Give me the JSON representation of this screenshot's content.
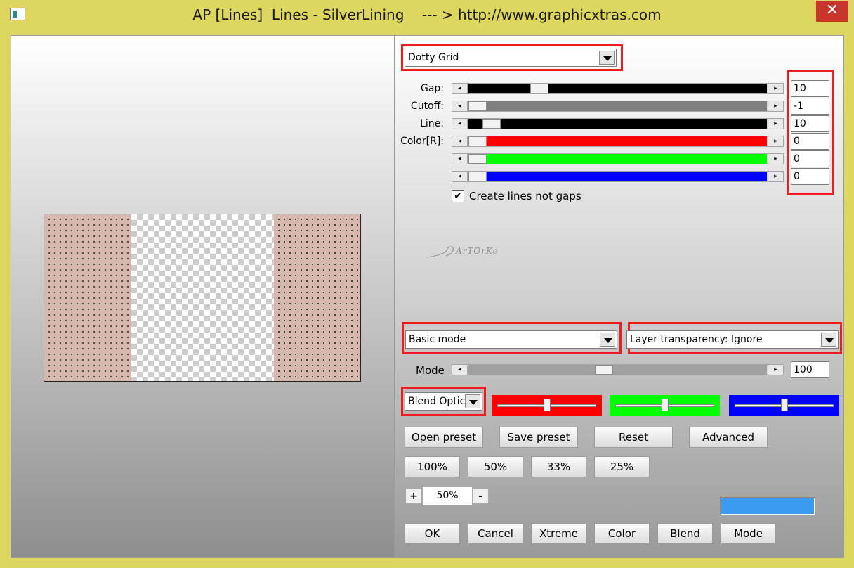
{
  "window": {
    "title": "AP [Lines]  Lines - SilverLining    --- > http://www.graphicxtras.com",
    "close_glyph": "✕"
  },
  "pattern_dropdown": {
    "value": "Dotty Grid"
  },
  "sliders": [
    {
      "label": "Gap:",
      "value": "10",
      "fill": "#000000",
      "thumb_fraction": 0.22
    },
    {
      "label": "Cutoff:",
      "value": "-1",
      "fill": "#808080",
      "thumb_fraction": 0.0
    },
    {
      "label": "Line:",
      "value": "10",
      "fill": "#000000",
      "thumb_fraction": 0.05
    },
    {
      "label": "Color[R]:",
      "value": "0",
      "fill": "#ff0000",
      "thumb_fraction": 0.0
    },
    {
      "label": "",
      "value": "0",
      "fill": "#00ff00",
      "thumb_fraction": 0.0
    },
    {
      "label": "",
      "value": "0",
      "fill": "#0000ff",
      "thumb_fraction": 0.0
    }
  ],
  "checkbox": {
    "label": "Create lines not gaps",
    "checked": true,
    "glyph": "✔"
  },
  "watermark": "ArTOrKe",
  "mode_dropdown": {
    "value": "Basic mode"
  },
  "transparency_dropdown": {
    "value": "Layer transparency: Ignore"
  },
  "mode_slider": {
    "label": "Mode",
    "value": "100",
    "thumb_fraction": 0.45
  },
  "blend_dropdown": {
    "value": "Blend Optic"
  },
  "blend_colors": [
    {
      "color": "#ff0000",
      "thumb_fraction": 0.5
    },
    {
      "color": "#00ff00",
      "thumb_fraction": 0.5
    },
    {
      "color": "#0000ff",
      "thumb_fraction": 0.5
    }
  ],
  "preset_buttons": {
    "open": "Open preset",
    "save": "Save preset",
    "reset": "Reset",
    "advanced": "Advanced"
  },
  "zoom_buttons": {
    "z100": "100%",
    "z50": "50%",
    "z33": "33%",
    "z25": "25%"
  },
  "zoom": {
    "plus": "+",
    "minus": "-",
    "value": "50%"
  },
  "swatch_color": "#3a9af0",
  "bottom_buttons": {
    "ok": "OK",
    "cancel": "Cancel",
    "xtreme": "Xtreme",
    "color": "Color",
    "blend": "Blend",
    "mode": "Mode"
  },
  "arrows": {
    "left": "◂",
    "right": "▸"
  }
}
